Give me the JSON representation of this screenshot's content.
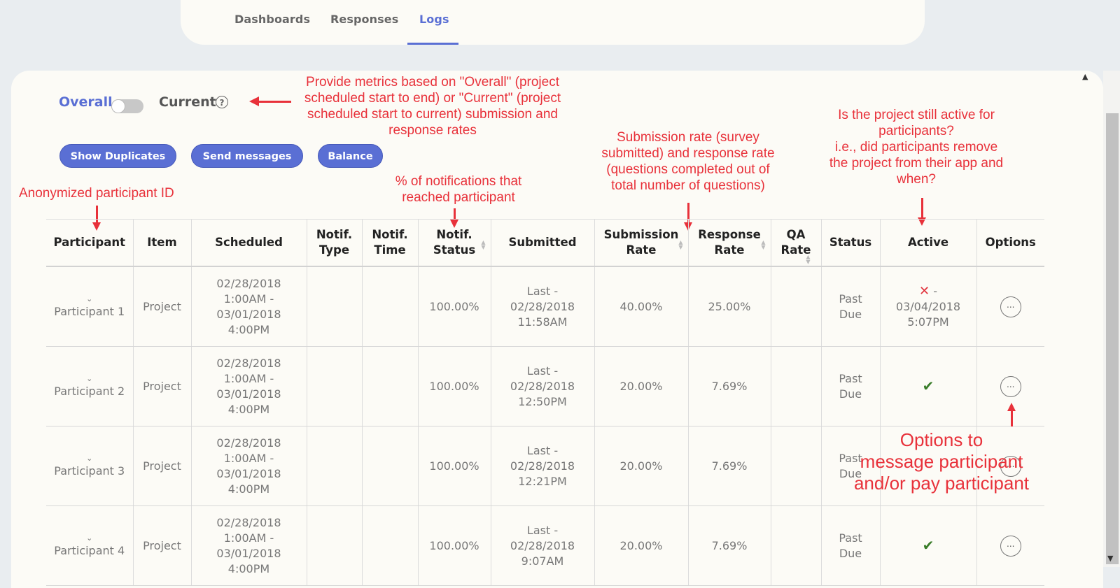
{
  "tabs": [
    {
      "label": "Dashboards"
    },
    {
      "label": "Responses"
    },
    {
      "label": "Logs",
      "active": true
    }
  ],
  "toggle": {
    "overall_label": "Overall",
    "current_label": "Current",
    "help_icon": "?",
    "state": "off"
  },
  "buttons": {
    "show_duplicates": "Show Duplicates",
    "send_messages": "Send messages",
    "balance": "Balance"
  },
  "annotations": {
    "overall_current": [
      "Provide metrics based on \"Overall\" (project",
      "scheduled start to end) or \"Current\" (project",
      "scheduled start to current) submission and",
      "response rates"
    ],
    "participant_id": "Anonymized participant ID",
    "notif": [
      "% of notifications that",
      "reached participant"
    ],
    "submission_rate": [
      "Submission rate (survey",
      "submitted) and response rate",
      "(questions completed out of",
      "total number of questions)"
    ],
    "active": [
      "Is the project still active for",
      "participants?",
      "i.e., did participants remove",
      "the project from their app and",
      "when?"
    ],
    "options": [
      "Options to",
      "message participant",
      "and/or pay participant"
    ]
  },
  "table": {
    "headers": [
      {
        "line1": "Participant",
        "line2": ""
      },
      {
        "line1": "Item",
        "line2": ""
      },
      {
        "line1": "Scheduled",
        "line2": ""
      },
      {
        "line1": "Notif.",
        "line2": "Type"
      },
      {
        "line1": "Notif.",
        "line2": "Time"
      },
      {
        "line1": "Notif.",
        "line2": "Status"
      },
      {
        "line1": "Submitted",
        "line2": ""
      },
      {
        "line1": "Submission",
        "line2": "Rate"
      },
      {
        "line1": "Response",
        "line2": "Rate"
      },
      {
        "line1": "QA",
        "line2": "Rate"
      },
      {
        "line1": "Status",
        "line2": ""
      },
      {
        "line1": "Active",
        "line2": ""
      },
      {
        "line1": "Options",
        "line2": ""
      }
    ],
    "rows": [
      {
        "participant": "Participant 1",
        "item": "Project",
        "sched1": "02/28/2018",
        "sched2": "1:00AM -",
        "sched3": "03/01/2018",
        "sched4": "4:00PM",
        "notif_status": "100.00%",
        "sub1": "Last -",
        "sub2": "02/28/2018",
        "sub3": "11:58AM",
        "submission_rate": "40.00%",
        "response_rate": "25.00%",
        "status1": "Past",
        "status2": "Due",
        "active_date": "03/04/2018",
        "active_time": "5:07PM",
        "options": "..."
      },
      {
        "participant": "Participant 2",
        "item": "Project",
        "sched1": "02/28/2018",
        "sched2": "1:00AM -",
        "sched3": "03/01/2018",
        "sched4": "4:00PM",
        "notif_status": "100.00%",
        "sub1": "Last -",
        "sub2": "02/28/2018",
        "sub3": "12:50PM",
        "submission_rate": "20.00%",
        "response_rate": "7.69%",
        "status1": "Past",
        "status2": "Due",
        "options": "..."
      },
      {
        "participant": "Participant 3",
        "item": "Project",
        "sched1": "02/28/2018",
        "sched2": "1:00AM -",
        "sched3": "03/01/2018",
        "sched4": "4:00PM",
        "notif_status": "100.00%",
        "sub1": "Last -",
        "sub2": "02/28/2018",
        "sub3": "12:21PM",
        "submission_rate": "20.00%",
        "response_rate": "7.69%",
        "status1": "Past",
        "status2": "Due",
        "options": "..."
      },
      {
        "participant": "Participant 4",
        "item": "Project",
        "sched1": "02/28/2018",
        "sched2": "1:00AM -",
        "sched3": "03/01/2018",
        "sched4": "4:00PM",
        "notif_status": "100.00%",
        "sub1": "Last -",
        "sub2": "02/28/2018",
        "sub3": "9:07AM",
        "submission_rate": "20.00%",
        "response_rate": "7.69%",
        "status1": "Past",
        "status2": "Due",
        "options": "..."
      }
    ]
  },
  "colors": {
    "accent": "#5a6fd4",
    "annotation": "#e8313a",
    "check": "#3a7d2a"
  },
  "icons": [
    "help-circle-icon",
    "chevron-down-icon",
    "check-icon",
    "x-icon",
    "ellipsis-icon",
    "sort-icon"
  ]
}
